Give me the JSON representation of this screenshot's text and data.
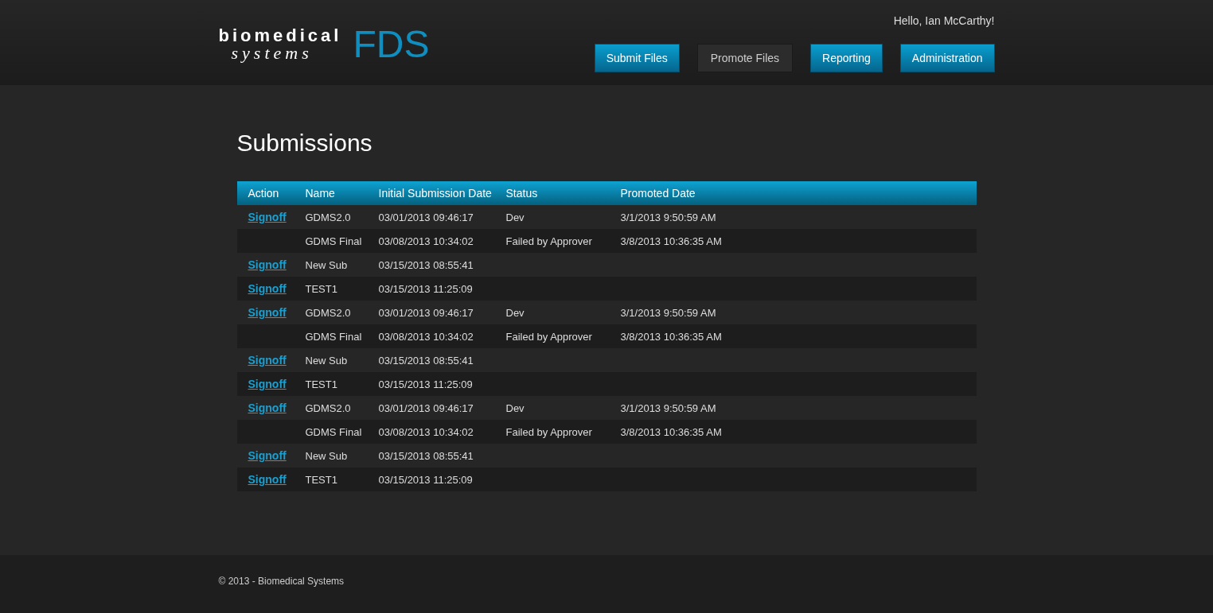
{
  "header": {
    "logo": {
      "line_1": "biomedical",
      "line_2": "systems",
      "product": "FDS"
    },
    "greeting": "Hello, Ian McCarthy!",
    "nav": [
      {
        "label": "Submit Files",
        "selected": false
      },
      {
        "label": "Promote Files",
        "selected": true
      },
      {
        "label": "Reporting",
        "selected": false
      },
      {
        "label": "Administration",
        "selected": false
      }
    ]
  },
  "page_title": "Submissions",
  "table": {
    "columns": [
      "Action",
      "Name",
      "Initial Submission Date",
      "Status",
      "Promoted Date"
    ],
    "rows": [
      {
        "action": "Signoff",
        "name": "GDMS2.0",
        "initial_date": "03/01/2013 09:46:17",
        "status": "Dev",
        "promoted_date": "3/1/2013 9:50:59 AM"
      },
      {
        "name": "GDMS Final",
        "initial_date": "03/08/2013 10:34:02",
        "status": "Failed by Approver",
        "promoted_date": "3/8/2013 10:36:35 AM"
      },
      {
        "action": "Signoff",
        "name": "New Sub",
        "initial_date": "03/15/2013 08:55:41"
      },
      {
        "action": "Signoff",
        "name": "TEST1",
        "initial_date": "03/15/2013 11:25:09"
      },
      {
        "action": "Signoff",
        "name": "GDMS2.0",
        "initial_date": "03/01/2013 09:46:17",
        "status": "Dev",
        "promoted_date": "3/1/2013 9:50:59 AM"
      },
      {
        "name": "GDMS Final",
        "initial_date": "03/08/2013 10:34:02",
        "status": "Failed by Approver",
        "promoted_date": "3/8/2013 10:36:35 AM"
      },
      {
        "action": "Signoff",
        "name": "New Sub",
        "initial_date": "03/15/2013 08:55:41"
      },
      {
        "action": "Signoff",
        "name": "TEST1",
        "initial_date": "03/15/2013 11:25:09"
      },
      {
        "action": "Signoff",
        "name": "GDMS2.0",
        "initial_date": "03/01/2013 09:46:17",
        "status": "Dev",
        "promoted_date": "3/1/2013 9:50:59 AM"
      },
      {
        "name": "GDMS Final",
        "initial_date": "03/08/2013 10:34:02",
        "status": "Failed by Approver",
        "promoted_date": "3/8/2013 10:36:35 AM"
      },
      {
        "action": "Signoff",
        "name": "New Sub",
        "initial_date": "03/15/2013 08:55:41"
      },
      {
        "action": "Signoff",
        "name": "TEST1",
        "initial_date": "03/15/2013 11:25:09"
      }
    ]
  },
  "footer": {
    "copyright": "© 2013 - Biomedical Systems"
  }
}
